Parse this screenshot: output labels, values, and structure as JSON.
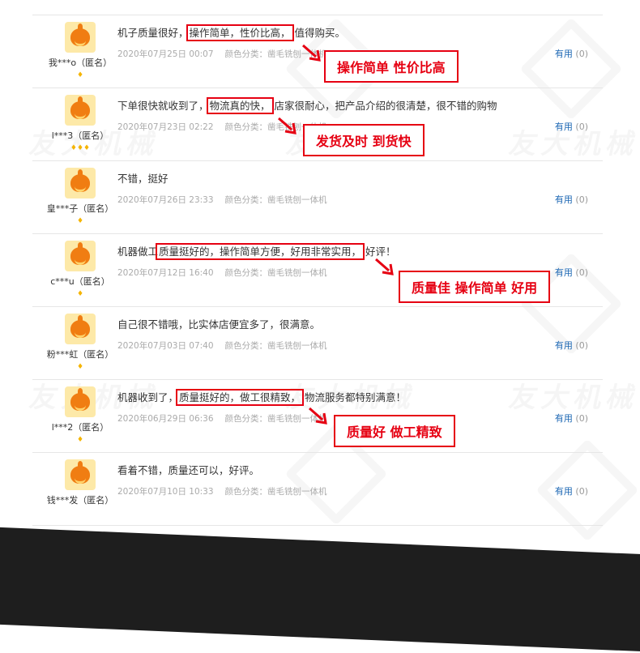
{
  "watermark": {
    "text": "友大机械"
  },
  "reviews": [
    {
      "user": "我***o（匿名）",
      "badges": "♦",
      "text_pre": "机子质量很好，",
      "text_hl": "操作简单，性价比高，",
      "text_post": "值得购买。",
      "date": "2020年07月25日 00:07",
      "spec": "颜色分类：凿毛铣刨一体机",
      "useful_label": "有用",
      "useful_count": "(0)",
      "callout": "操作简单 性价比高"
    },
    {
      "user": "l***3（匿名）",
      "badges": "♦♦♦",
      "text_pre": "下单很快就收到了，",
      "text_hl": "物流真的快，",
      "text_post": "店家很耐心，把产品介绍的很清楚，很不错的购物",
      "date": "2020年07月23日 02:22",
      "spec": "颜色分类：凿毛铣刨一体机",
      "useful_label": "有用",
      "useful_count": "(0)",
      "callout": "发货及时 到货快"
    },
    {
      "user": "皇***子（匿名）",
      "badges": "♦",
      "text_pre": "不错，挺好",
      "text_hl": "",
      "text_post": "",
      "date": "2020年07月26日 23:33",
      "spec": "颜色分类：凿毛铣刨一体机",
      "useful_label": "有用",
      "useful_count": "(0)",
      "callout": ""
    },
    {
      "user": "c***u（匿名）",
      "badges": "♦",
      "text_pre": "机器做工",
      "text_hl": "质量挺好的，操作简单方便，好用非常实用，",
      "text_post": "好评！",
      "date": "2020年07月12日 16:40",
      "spec": "颜色分类：凿毛铣刨一体机",
      "useful_label": "有用",
      "useful_count": "(0)",
      "callout": "质量佳 操作简单 好用"
    },
    {
      "user": "粉***虹（匿名）",
      "badges": "♦",
      "text_pre": "自己很不错哦，比实体店便宜多了，很满意。",
      "text_hl": "",
      "text_post": "",
      "date": "2020年07月03日 07:40",
      "spec": "颜色分类：凿毛铣刨一体机",
      "useful_label": "有用",
      "useful_count": "(0)",
      "callout": ""
    },
    {
      "user": "l***2（匿名）",
      "badges": "♦",
      "text_pre": "机器收到了，",
      "text_hl": "质量挺好的，做工很精致，",
      "text_post": "物流服务都特别满意！",
      "date": "2020年06月29日 06:36",
      "spec": "颜色分类：凿毛铣刨一体机",
      "useful_label": "有用",
      "useful_count": "(0)",
      "callout": "质量好 做工精致"
    },
    {
      "user": "钱***发（匿名）",
      "badges": "",
      "text_pre": "看着不错，质量还可以，好评。",
      "text_hl": "",
      "text_post": "",
      "date": "2020年07月10日 10:33",
      "spec": "颜色分类：凿毛铣刨一体机",
      "useful_label": "有用",
      "useful_count": "(0)",
      "callout": ""
    }
  ]
}
